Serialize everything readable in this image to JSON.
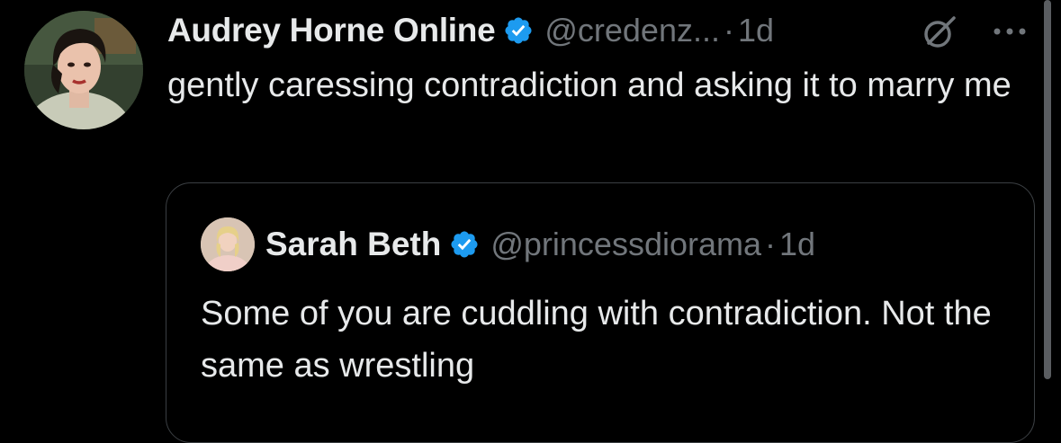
{
  "tweet": {
    "display_name": "Audrey Horne Online",
    "handle": "@credenz...",
    "separator": "·",
    "time": "1d",
    "text": "gently caressing contradiction and asking it to marry me",
    "verified_icon": "verified-badge-icon",
    "grok_icon": "grok-icon",
    "more_icon": "more-options-icon"
  },
  "quote": {
    "display_name": "Sarah Beth",
    "handle": "@princessdiorama",
    "separator": "·",
    "time": "1d",
    "text": "Some of you are cuddling with contradiction. Not the same as wrestling",
    "verified_icon": "verified-badge-icon"
  },
  "colors": {
    "background": "#000000",
    "text_primary": "#e7e9ea",
    "text_secondary": "#71767b",
    "verified_blue": "#1d9bf0",
    "quote_border": "#3b3f43",
    "scrollbar": "#5a5d61"
  }
}
